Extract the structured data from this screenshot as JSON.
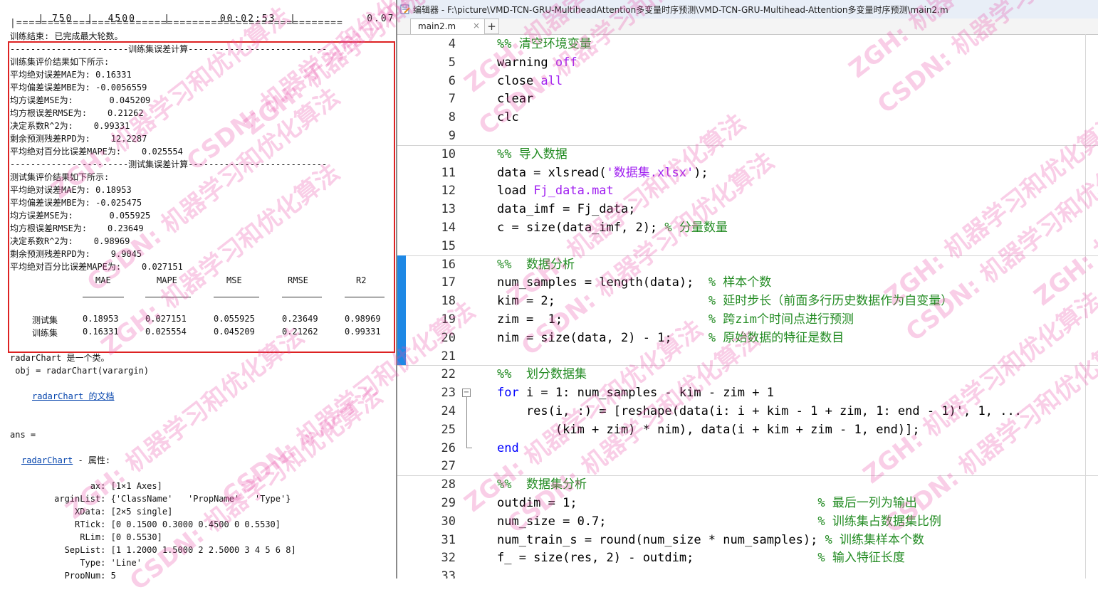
{
  "command_window": {
    "top_row": {
      "col1": "750",
      "col2": "4500",
      "col3": "00:02:53",
      "col4": "0.07"
    },
    "separator": "|====================================================",
    "training_done": "训练结束: 已完成最大轮数。",
    "train_header": "-----------------------训练集误差计算---------------------------",
    "train_intro": "训练集评价结果如下所示:",
    "train_metrics": [
      "平均绝对误差MAE为: 0.16331",
      "平均偏差误差MBE为: -0.0056559",
      "均方误差MSE为:       0.045209",
      "均方根误差RMSE为:    0.21262",
      "决定系数R^2为:    0.99331",
      "剩余预测残差RPD为:    12.2287",
      "平均绝对百分比误差MAPE为:    0.025554"
    ],
    "test_header": "-----------------------测试集误差计算---------------------------",
    "test_intro": "测试集评价结果如下所示:",
    "test_metrics": [
      "平均绝对误差MAE为: 0.18953",
      "平均偏差误差MBE为: -0.025475",
      "均方误差MSE为:       0.055925",
      "均方根误差RMSE为:    0.23649",
      "决定系数R^2为:    0.98969",
      "剩余预测残差RPD为:    9.9045",
      "平均绝对百分比误差MAPE为:    0.027151"
    ],
    "table": {
      "columns": [
        "MAE",
        "MAPE",
        "MSE",
        "RMSE",
        "R2"
      ],
      "rows": [
        {
          "name": "测试集",
          "values": [
            "0.18953",
            "0.027151",
            "0.055925",
            "0.23649",
            "0.98969"
          ]
        },
        {
          "name": "训练集",
          "values": [
            "0.16331",
            "0.025554",
            "0.045209",
            "0.21262",
            "0.99331"
          ]
        }
      ]
    },
    "class_line": "radarChart 是一个类。",
    "constructor_line": " obj = radarChart(varargin)",
    "doc_link": "radarChart 的文档",
    "ans_line": "ans =",
    "props_link": "radarChart",
    "props_suffix": " - 属性:",
    "properties": [
      "            ax: [1×1 Axes]",
      "     arginList: {'ClassName'   'PropName'   'Type'}",
      "         XData: [2×5 single]",
      "         RTick: [0 0.1500 0.3000 0.4500 0 0.5530]",
      "          RLim: [0 0.5530]",
      "       SepList: [1 1.2000 1.5000 2 2.5000 3 4 5 6 8]",
      "          Type: 'Line'",
      "       PropNum: 5"
    ]
  },
  "editor": {
    "title": "编辑器 - F:\\picture\\VMD-TCN-GRU-MultiheadAttention多变量时序预测\\VMD-TCN-GRU-Multihead-Attention多变量时序预测\\main2.m",
    "tab_label": "main2.m",
    "tab_close": "×",
    "tab_add": "+",
    "lines": [
      {
        "n": "4",
        "parts": [
          [
            "cm",
            "%% 清空环境变量"
          ]
        ]
      },
      {
        "n": "5",
        "parts": [
          [
            "",
            "warning "
          ],
          [
            "str",
            "off"
          ]
        ]
      },
      {
        "n": "6",
        "parts": [
          [
            "",
            "close "
          ],
          [
            "str",
            "all"
          ]
        ]
      },
      {
        "n": "7",
        "parts": [
          [
            "",
            "clear"
          ]
        ]
      },
      {
        "n": "8",
        "parts": [
          [
            "",
            "clc"
          ]
        ]
      },
      {
        "n": "9",
        "parts": []
      },
      {
        "n": "10",
        "parts": [
          [
            "cm",
            "%% 导入数据"
          ]
        ]
      },
      {
        "n": "11",
        "parts": [
          [
            "",
            "data = xlsread("
          ],
          [
            "str",
            "'数据集.xlsx'"
          ],
          [
            "",
            ");"
          ]
        ]
      },
      {
        "n": "12",
        "parts": [
          [
            "",
            "load "
          ],
          [
            "str",
            "Fj_data.mat"
          ]
        ]
      },
      {
        "n": "13",
        "parts": [
          [
            "",
            "data_imf = Fj_data;"
          ]
        ]
      },
      {
        "n": "14",
        "parts": [
          [
            "",
            "c = size(data_imf, 2); "
          ],
          [
            "cm",
            "% 分量数量"
          ]
        ]
      },
      {
        "n": "15",
        "parts": []
      },
      {
        "n": "16",
        "parts": [
          [
            "cm",
            "%%  数据分析"
          ]
        ]
      },
      {
        "n": "17",
        "parts": [
          [
            "",
            "num_samples = length(data);  "
          ],
          [
            "cm",
            "% 样本个数"
          ]
        ]
      },
      {
        "n": "18",
        "parts": [
          [
            "",
            "kim = 2;                     "
          ],
          [
            "cm",
            "% 延时步长（前面多行历史数据作为自变量）"
          ]
        ]
      },
      {
        "n": "19",
        "parts": [
          [
            "",
            "zim =  1;                    "
          ],
          [
            "cm",
            "% 跨zim个时间点进行预测"
          ]
        ]
      },
      {
        "n": "20",
        "parts": [
          [
            "",
            "nim = size(data, 2) - 1;     "
          ],
          [
            "cm",
            "% 原始数据的特征是数目"
          ]
        ]
      },
      {
        "n": "21",
        "parts": []
      },
      {
        "n": "22",
        "parts": [
          [
            "cm",
            "%%  划分数据集"
          ]
        ]
      },
      {
        "n": "23",
        "parts": [
          [
            "kw",
            "for"
          ],
          [
            "",
            " i = 1: num_samples - kim - zim + 1"
          ]
        ]
      },
      {
        "n": "24",
        "parts": [
          [
            "",
            "    res(i, :) = [reshape(data(i: i + kim - 1 + zim, 1: end - 1)', 1, ..."
          ]
        ]
      },
      {
        "n": "25",
        "parts": [
          [
            "",
            "        (kim + zim) * nim), data(i + kim + zim - 1, end)];"
          ]
        ]
      },
      {
        "n": "26",
        "parts": [
          [
            "kw",
            "end"
          ]
        ]
      },
      {
        "n": "27",
        "parts": []
      },
      {
        "n": "28",
        "parts": [
          [
            "cm",
            "%%  数据集分析"
          ]
        ]
      },
      {
        "n": "29",
        "parts": [
          [
            "",
            "outdim = 1;                                 "
          ],
          [
            "cm",
            "% 最后一列为输出"
          ]
        ]
      },
      {
        "n": "30",
        "parts": [
          [
            "",
            "num_size = 0.7;                             "
          ],
          [
            "cm",
            "% 训练集占数据集比例"
          ]
        ]
      },
      {
        "n": "31",
        "parts": [
          [
            "",
            "num_train_s = round(num_size * num_samples); "
          ],
          [
            "cm",
            "% 训练集样本个数"
          ]
        ]
      },
      {
        "n": "32",
        "parts": [
          [
            "",
            "f_ = size(res, 2) - outdim;                 "
          ],
          [
            "cm",
            "% 输入特征长度"
          ]
        ]
      },
      {
        "n": "33",
        "parts": []
      }
    ]
  },
  "watermark": {
    "prefix1": "ZGH:",
    "prefix2": "CSDN:",
    "text": "机器学习和优化算法"
  },
  "colors": {
    "keyword": "#0000ff",
    "comment": "#228b22",
    "string": "#a020f0",
    "cell_bar": "#1e88e5",
    "highlight_box": "#dd2222"
  }
}
